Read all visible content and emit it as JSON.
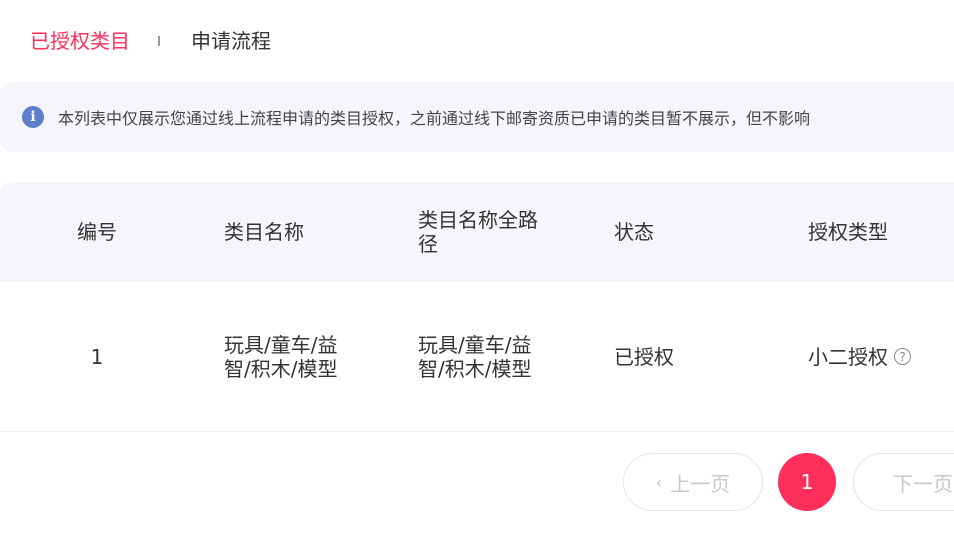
{
  "tabs": {
    "active_label": "已授权类目",
    "inactive_label": "申请流程"
  },
  "notice": {
    "icon": "info-icon",
    "text": "本列表中仅展示您通过线上流程申请的类目授权，之前通过线下邮寄资质已申请的类目暂不展示，但不影响"
  },
  "table": {
    "headers": {
      "id": "编号",
      "name": "类目名称",
      "path": "类目名称全路径",
      "status": "状态",
      "type": "授权类型"
    },
    "rows": [
      {
        "id": "1",
        "name": "玩具/童车/益智/积木/模型",
        "path": "玩具/童车/益智/积木/模型",
        "status": "已授权",
        "type": "小二授权"
      }
    ]
  },
  "pagination": {
    "prev_label": "上一页",
    "current_page": "1",
    "next_label": "下一页"
  },
  "colors": {
    "accent": "#ff2e5b",
    "info": "#5d7fc9",
    "panel_bg": "#f5f6fa"
  }
}
